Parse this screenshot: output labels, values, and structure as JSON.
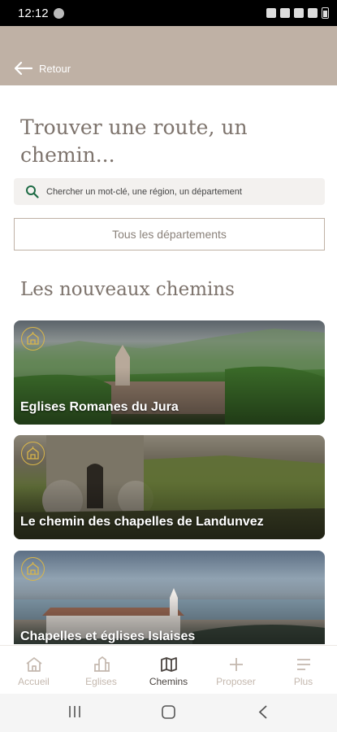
{
  "status_bar": {
    "time": "12:12"
  },
  "header": {
    "back_label": "Retour"
  },
  "page": {
    "title": "Trouver une route, un chemin...",
    "search_placeholder": "Chercher un mot-clé, une région, un département",
    "department_button": "Tous les départements",
    "section_title": "Les nouveaux chemins"
  },
  "cards": [
    {
      "title": "Eglises Romanes du Jura"
    },
    {
      "title": "Le chemin des chapelles de Landunvez"
    },
    {
      "title": "Chapelles et églises Islaises"
    }
  ],
  "bottom_nav": [
    {
      "label": "Accueil",
      "icon": "home-icon"
    },
    {
      "label": "Eglises",
      "icon": "church-icon"
    },
    {
      "label": "Chemins",
      "icon": "map-icon",
      "active": true
    },
    {
      "label": "Proposer",
      "icon": "plus-icon"
    },
    {
      "label": "Plus",
      "icon": "menu-icon"
    }
  ],
  "colors": {
    "header": "#bfb1a5",
    "accent_gold": "#d9b64a",
    "title_text": "#7d736c"
  }
}
